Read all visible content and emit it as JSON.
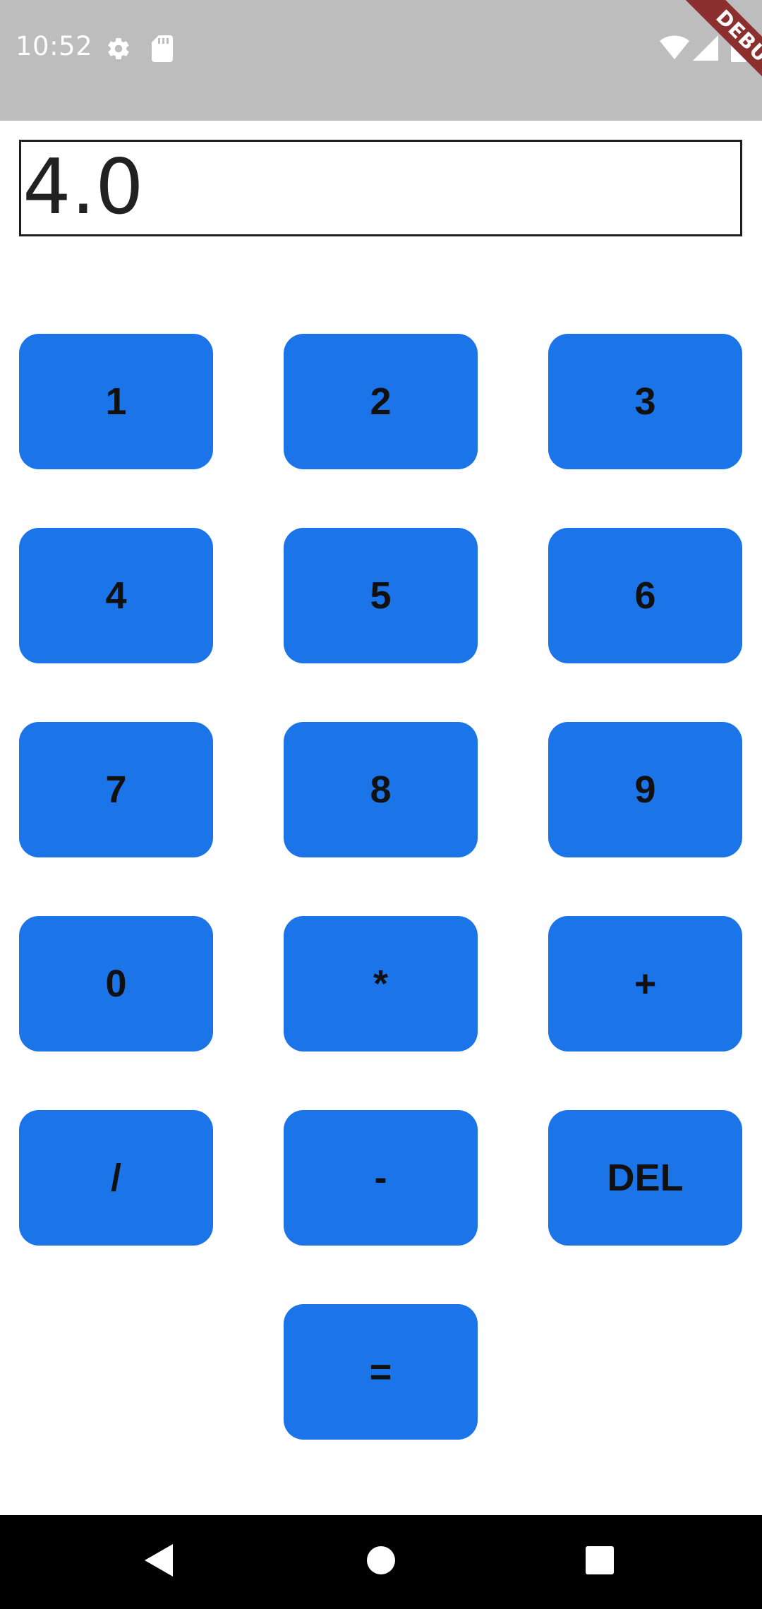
{
  "status_bar": {
    "time": "10:52",
    "icons": [
      "gear-icon",
      "sd-card-icon",
      "wifi-icon",
      "signal-icon",
      "battery-icon"
    ]
  },
  "debug_banner": {
    "label": "DEBUG"
  },
  "display": {
    "value": "4.0"
  },
  "keypad": {
    "color": "#1b74e8",
    "keys": [
      "1",
      "2",
      "3",
      "4",
      "5",
      "6",
      "7",
      "8",
      "9",
      "0",
      "*",
      "+",
      "/",
      "-",
      "DEL",
      "="
    ]
  },
  "nav_bar": {
    "icons": [
      "back-icon",
      "home-icon",
      "recents-icon"
    ]
  }
}
